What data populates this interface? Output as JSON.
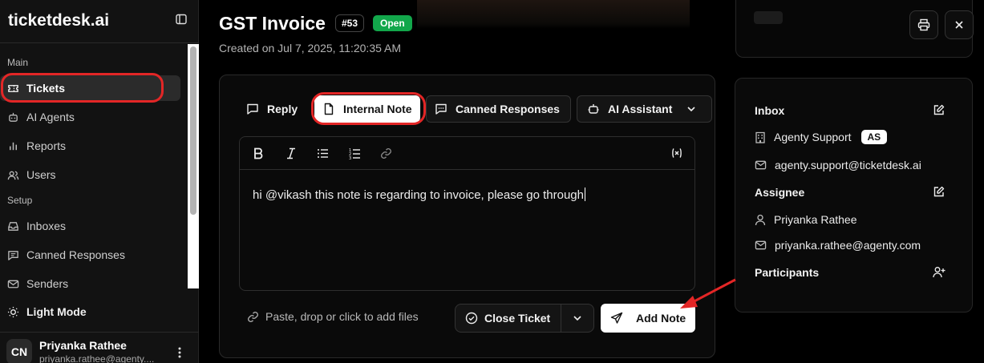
{
  "sidebar": {
    "logo": "ticketdesk.ai",
    "section_main": "Main",
    "section_setup": "Setup",
    "items": [
      {
        "label": "Tickets",
        "icon": "ticket-icon"
      },
      {
        "label": "AI Agents",
        "icon": "bot-icon"
      },
      {
        "label": "Reports",
        "icon": "bar-chart-icon"
      },
      {
        "label": "Users",
        "icon": "users-icon"
      },
      {
        "label": "Inboxes",
        "icon": "inbox-icon"
      },
      {
        "label": "Canned Responses",
        "icon": "message-square-icon"
      },
      {
        "label": "Senders",
        "icon": "mail-icon"
      }
    ],
    "active_item": "Tickets",
    "light_mode": "Light Mode",
    "user": {
      "initials": "CN",
      "name": "Priyanka Rathee",
      "email": "priyanka.rathee@agenty...."
    }
  },
  "ticket": {
    "title": "GST Invoice",
    "number": "#53",
    "status": "Open",
    "created": "Created on Jul 7, 2025, 11:20:35 AM"
  },
  "composer": {
    "tabs": {
      "reply": "Reply",
      "internal_note": "Internal Note",
      "canned_responses": "Canned Responses",
      "ai_assistant": "AI Assistant"
    },
    "selected_tab": "Internal Note",
    "toolbar": [
      "bold-icon",
      "italic-icon",
      "bullet-list-icon",
      "numbered-list-icon",
      "link-icon",
      "variable-icon"
    ],
    "text": "hi @vikash this note is regarding to invoice, please go through",
    "attach_hint": "Paste, drop or click to add files",
    "close_ticket": "Close Ticket",
    "add_note": "Add Note"
  },
  "details": {
    "inbox_label": "Inbox",
    "inbox_name": "Agenty Support",
    "inbox_badge": "AS",
    "inbox_email": "agenty.support@ticketdesk.ai",
    "assignee_label": "Assignee",
    "assignee_name": "Priyanka Rathee",
    "assignee_email": "priyanka.rathee@agenty.com",
    "participants_label": "Participants"
  },
  "colors": {
    "open_badge": "#12a74b",
    "highlight": "#e32626",
    "background": "#000000"
  }
}
